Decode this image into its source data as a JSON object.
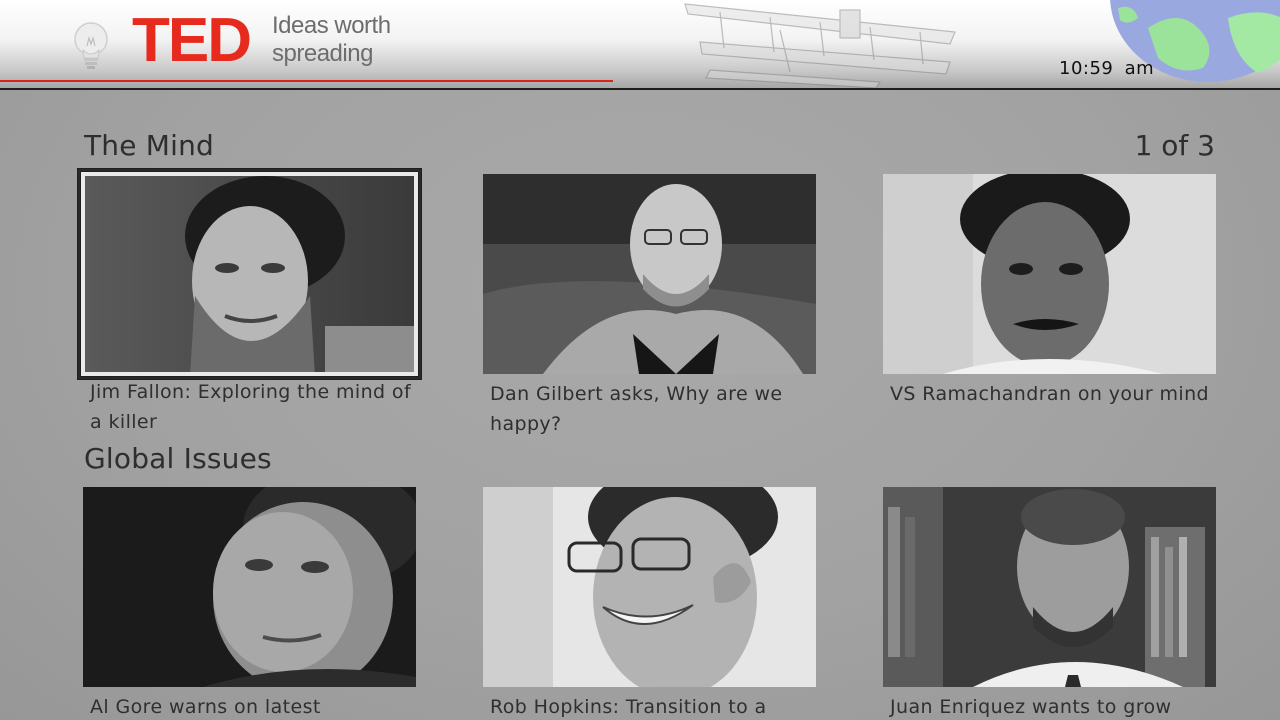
{
  "header": {
    "logo_text": "TED",
    "tagline_line1": "Ideas worth",
    "tagline_line2": "spreading",
    "clock": "10:59 am",
    "accent_color": "#e62b1e"
  },
  "sections": [
    {
      "title": "The Mind",
      "pager": "1 of 3",
      "tiles": [
        {
          "caption": "Jim Fallon: Exploring the mind of a killer",
          "selected": true
        },
        {
          "caption": "Dan Gilbert asks, Why are we happy?",
          "selected": false
        },
        {
          "caption": "VS Ramachandran on your mind",
          "selected": false
        }
      ]
    },
    {
      "title": "Global Issues",
      "tiles": [
        {
          "caption": "Al Gore warns on latest",
          "selected": false
        },
        {
          "caption": "Rob Hopkins: Transition to a",
          "selected": false
        },
        {
          "caption": "Juan Enriquez wants to grow",
          "selected": false
        }
      ]
    }
  ],
  "icons": {
    "bulb": "lightbulb-icon",
    "plane": "biplane-illustration",
    "globe": "globe-illustration"
  }
}
